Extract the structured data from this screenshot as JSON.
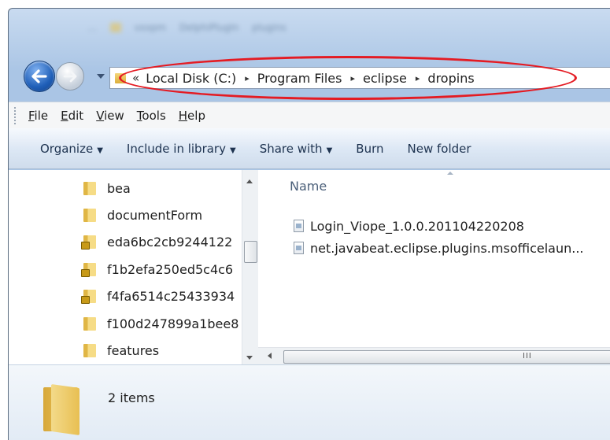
{
  "title_blur": [
    "…",
    "vxxpm",
    "DelphiPlugIn",
    "plugins"
  ],
  "address": {
    "overflow_glyph": "«",
    "crumbs": [
      "Local Disk (C:)",
      "Program Files",
      "eclipse",
      "dropins"
    ],
    "separator": "▸"
  },
  "menu": {
    "file": {
      "key": "F",
      "rest": "ile"
    },
    "edit": {
      "key": "E",
      "rest": "dit"
    },
    "view": {
      "key": "V",
      "rest": "iew"
    },
    "tools": {
      "key": "T",
      "rest": "ools"
    },
    "help": {
      "key": "H",
      "rest": "elp"
    }
  },
  "toolbar": {
    "organize": "Organize",
    "include_in_library": "Include in library",
    "share_with": "Share with",
    "burn": "Burn",
    "new_folder": "New folder",
    "caret": "▼"
  },
  "tree": {
    "items": [
      {
        "label": "bea",
        "locked": false
      },
      {
        "label": "documentForm",
        "locked": false
      },
      {
        "label": "eda6bc2cb9244122",
        "locked": true
      },
      {
        "label": "f1b2efa250ed5c4c6",
        "locked": true
      },
      {
        "label": "f4fa6514c25433934",
        "locked": true
      },
      {
        "label": "f100d247899a1bee8",
        "locked": false
      },
      {
        "label": "features",
        "locked": false
      }
    ]
  },
  "file_list": {
    "column_name": "Name",
    "files": [
      {
        "name": "Login_Viope_1.0.0.201104220208"
      },
      {
        "name": "net.javabeat.eclipse.plugins.msofficelaun..."
      }
    ]
  },
  "scroll_grip": "III",
  "details": {
    "item_count": "2 items"
  },
  "colors": {
    "highlight_ellipse": "#e41b23",
    "window_frame": "#aac5e5",
    "command_bar": "#dde8f5"
  }
}
